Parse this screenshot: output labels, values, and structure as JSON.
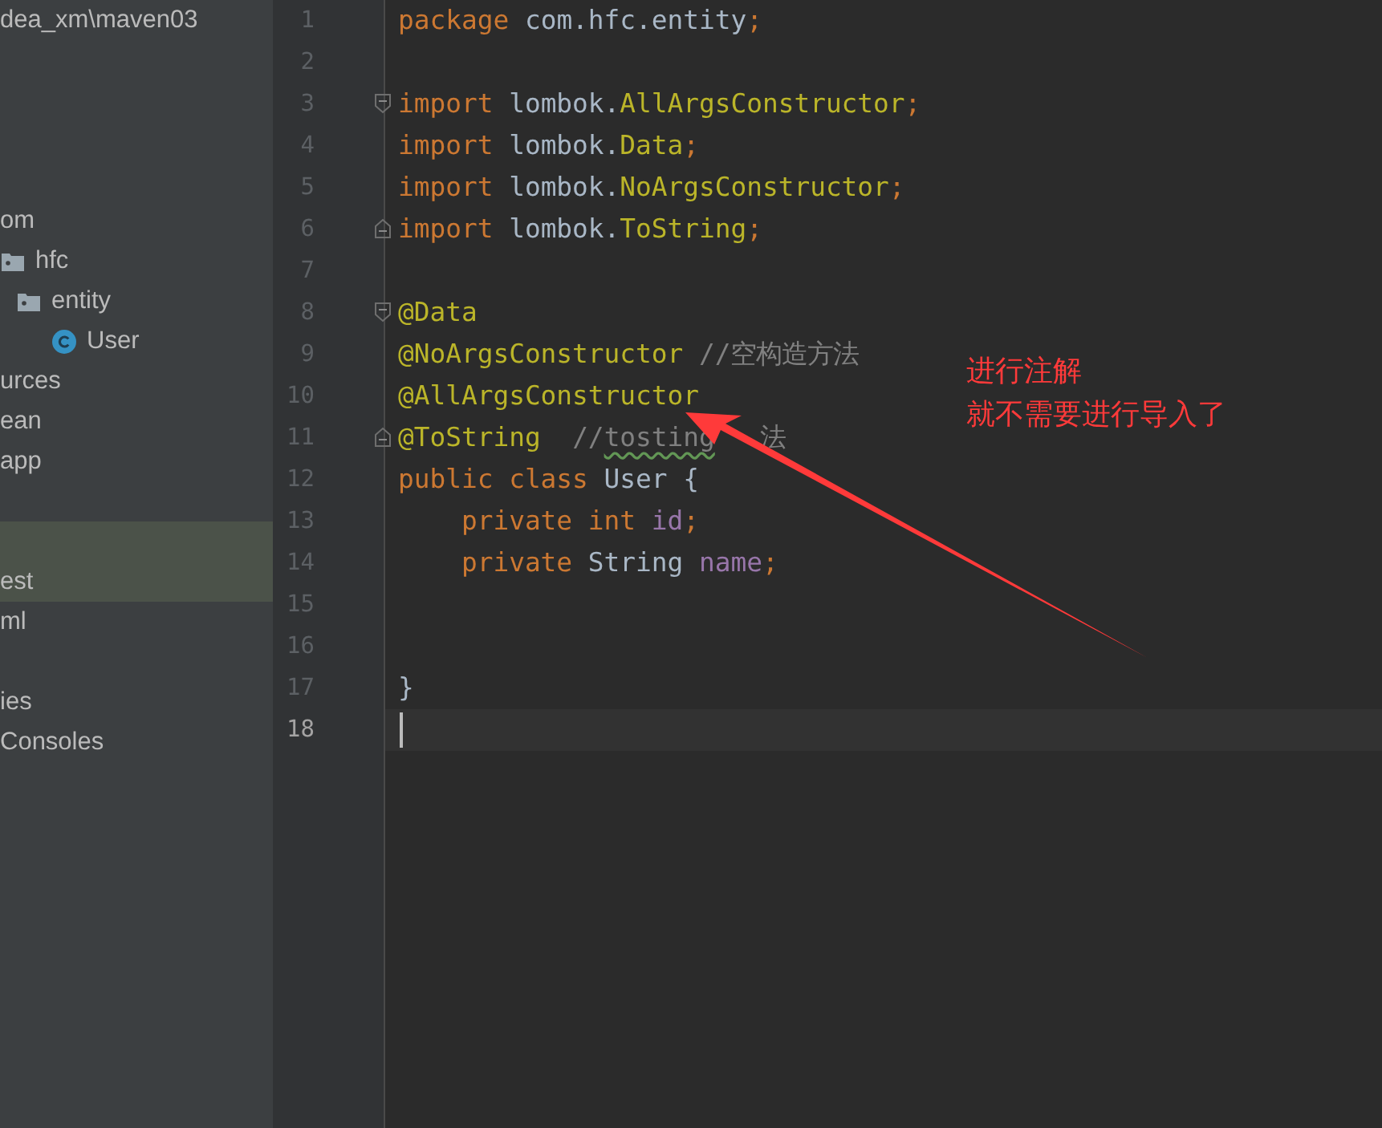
{
  "project_tree": {
    "rows": [
      {
        "label": "dea_xm\\maven03",
        "selected": false
      },
      {
        "selected": false
      },
      {
        "selected": false
      },
      {
        "selected": false
      },
      {
        "selected": false
      },
      {
        "label": "om",
        "selected": false,
        "children": [
          {
            "label": "hfc",
            "kind": "package",
            "selected": false,
            "children": [
              {
                "label": "entity",
                "kind": "package",
                "selected": false,
                "children": [
                  {
                    "label": "User",
                    "kind": "class",
                    "selected": false
                  }
                ]
              }
            ]
          }
        ]
      },
      {
        "label": "urces",
        "selected": false
      },
      {
        "label": "ean",
        "selected": false
      },
      {
        "label": "app",
        "selected": false
      },
      {
        "selected": false
      },
      {
        "label": "est",
        "selected": true
      },
      {
        "label": "ml",
        "selected": false
      },
      {
        "selected": false
      },
      {
        "label": "ies",
        "selected": false
      },
      {
        "label": "Consoles",
        "selected": false
      }
    ]
  },
  "editor": {
    "lines": [
      {
        "number": "1",
        "kind": "plain",
        "current": false,
        "tokens": [
          {
            "kind": "keyword",
            "text": "package "
          },
          {
            "kind": "plain",
            "text": "com.hfc.entity"
          },
          {
            "kind": "keyword",
            "text": ";"
          }
        ]
      },
      {
        "number": "2",
        "kind": "plain",
        "current": false
      },
      {
        "number": "3",
        "kind": "fold-start",
        "current": false,
        "tokens": [
          {
            "kind": "keyword",
            "text": "import "
          },
          {
            "kind": "plain",
            "text": "lombok."
          },
          {
            "kind": "annotation",
            "text": "AllArgsConstructor"
          },
          {
            "kind": "keyword",
            "text": ";"
          }
        ]
      },
      {
        "number": "4",
        "kind": "plain",
        "current": false,
        "tokens": [
          {
            "kind": "keyword",
            "text": "import "
          },
          {
            "kind": "plain",
            "text": "lombok."
          },
          {
            "kind": "annotation",
            "text": "Data"
          },
          {
            "kind": "keyword",
            "text": ";"
          }
        ]
      },
      {
        "number": "5",
        "kind": "plain",
        "current": false,
        "tokens": [
          {
            "kind": "keyword",
            "text": "import "
          },
          {
            "kind": "plain",
            "text": "lombok."
          },
          {
            "kind": "annotation",
            "text": "NoArgsConstructor"
          },
          {
            "kind": "keyword",
            "text": ";"
          }
        ]
      },
      {
        "number": "6",
        "kind": "fold-end",
        "current": false,
        "tokens": [
          {
            "kind": "keyword",
            "text": "import "
          },
          {
            "kind": "plain",
            "text": "lombok."
          },
          {
            "kind": "annotation",
            "text": "ToString"
          },
          {
            "kind": "keyword",
            "text": ";"
          }
        ]
      },
      {
        "number": "7",
        "kind": "plain",
        "current": false
      },
      {
        "number": "8",
        "kind": "fold-start",
        "current": false,
        "tokens": [
          {
            "kind": "annotation",
            "text": "@Data"
          }
        ]
      },
      {
        "number": "9",
        "kind": "plain",
        "current": false,
        "tokens": [
          {
            "kind": "annotation",
            "text": "@NoArgsConstructor "
          },
          {
            "kind": "comment",
            "text": "//空构造方法"
          }
        ]
      },
      {
        "number": "10",
        "kind": "plain",
        "current": false,
        "tokens": [
          {
            "kind": "annotation",
            "text": "@AllArgsConstructor"
          }
        ]
      },
      {
        "number": "11",
        "kind": "fold-end",
        "current": false,
        "tokens": [
          {
            "kind": "annotation",
            "text": "@ToString  "
          },
          {
            "kind": "comment",
            "text": "//"
          },
          {
            "kind": "typo",
            "text": "tosting"
          },
          {
            "kind": "covered",
            "text": "法"
          }
        ]
      },
      {
        "number": "12",
        "kind": "plain",
        "current": false,
        "tokens": [
          {
            "kind": "keyword",
            "text": "public class "
          },
          {
            "kind": "plain",
            "text": "User {"
          }
        ]
      },
      {
        "number": "13",
        "kind": "plain",
        "current": false,
        "tokens": [
          {
            "kind": "keyword",
            "text": "    private int "
          },
          {
            "kind": "field",
            "text": "id"
          },
          {
            "kind": "keyword",
            "text": ";"
          }
        ]
      },
      {
        "number": "14",
        "kind": "plain",
        "current": false,
        "tokens": [
          {
            "kind": "keyword",
            "text": "    private "
          },
          {
            "kind": "plain",
            "text": "String "
          },
          {
            "kind": "field",
            "text": "name"
          },
          {
            "kind": "keyword",
            "text": ";"
          }
        ]
      },
      {
        "number": "15",
        "kind": "plain",
        "current": false
      },
      {
        "number": "16",
        "kind": "plain",
        "current": false
      },
      {
        "number": "17",
        "kind": "plain",
        "current": false,
        "tokens": [
          {
            "kind": "plain",
            "text": "}"
          }
        ]
      },
      {
        "number": "18",
        "kind": "plain",
        "current": true
      }
    ]
  },
  "note": {
    "lines": [
      "进行注解",
      "就不需要进行导入了"
    ]
  }
}
